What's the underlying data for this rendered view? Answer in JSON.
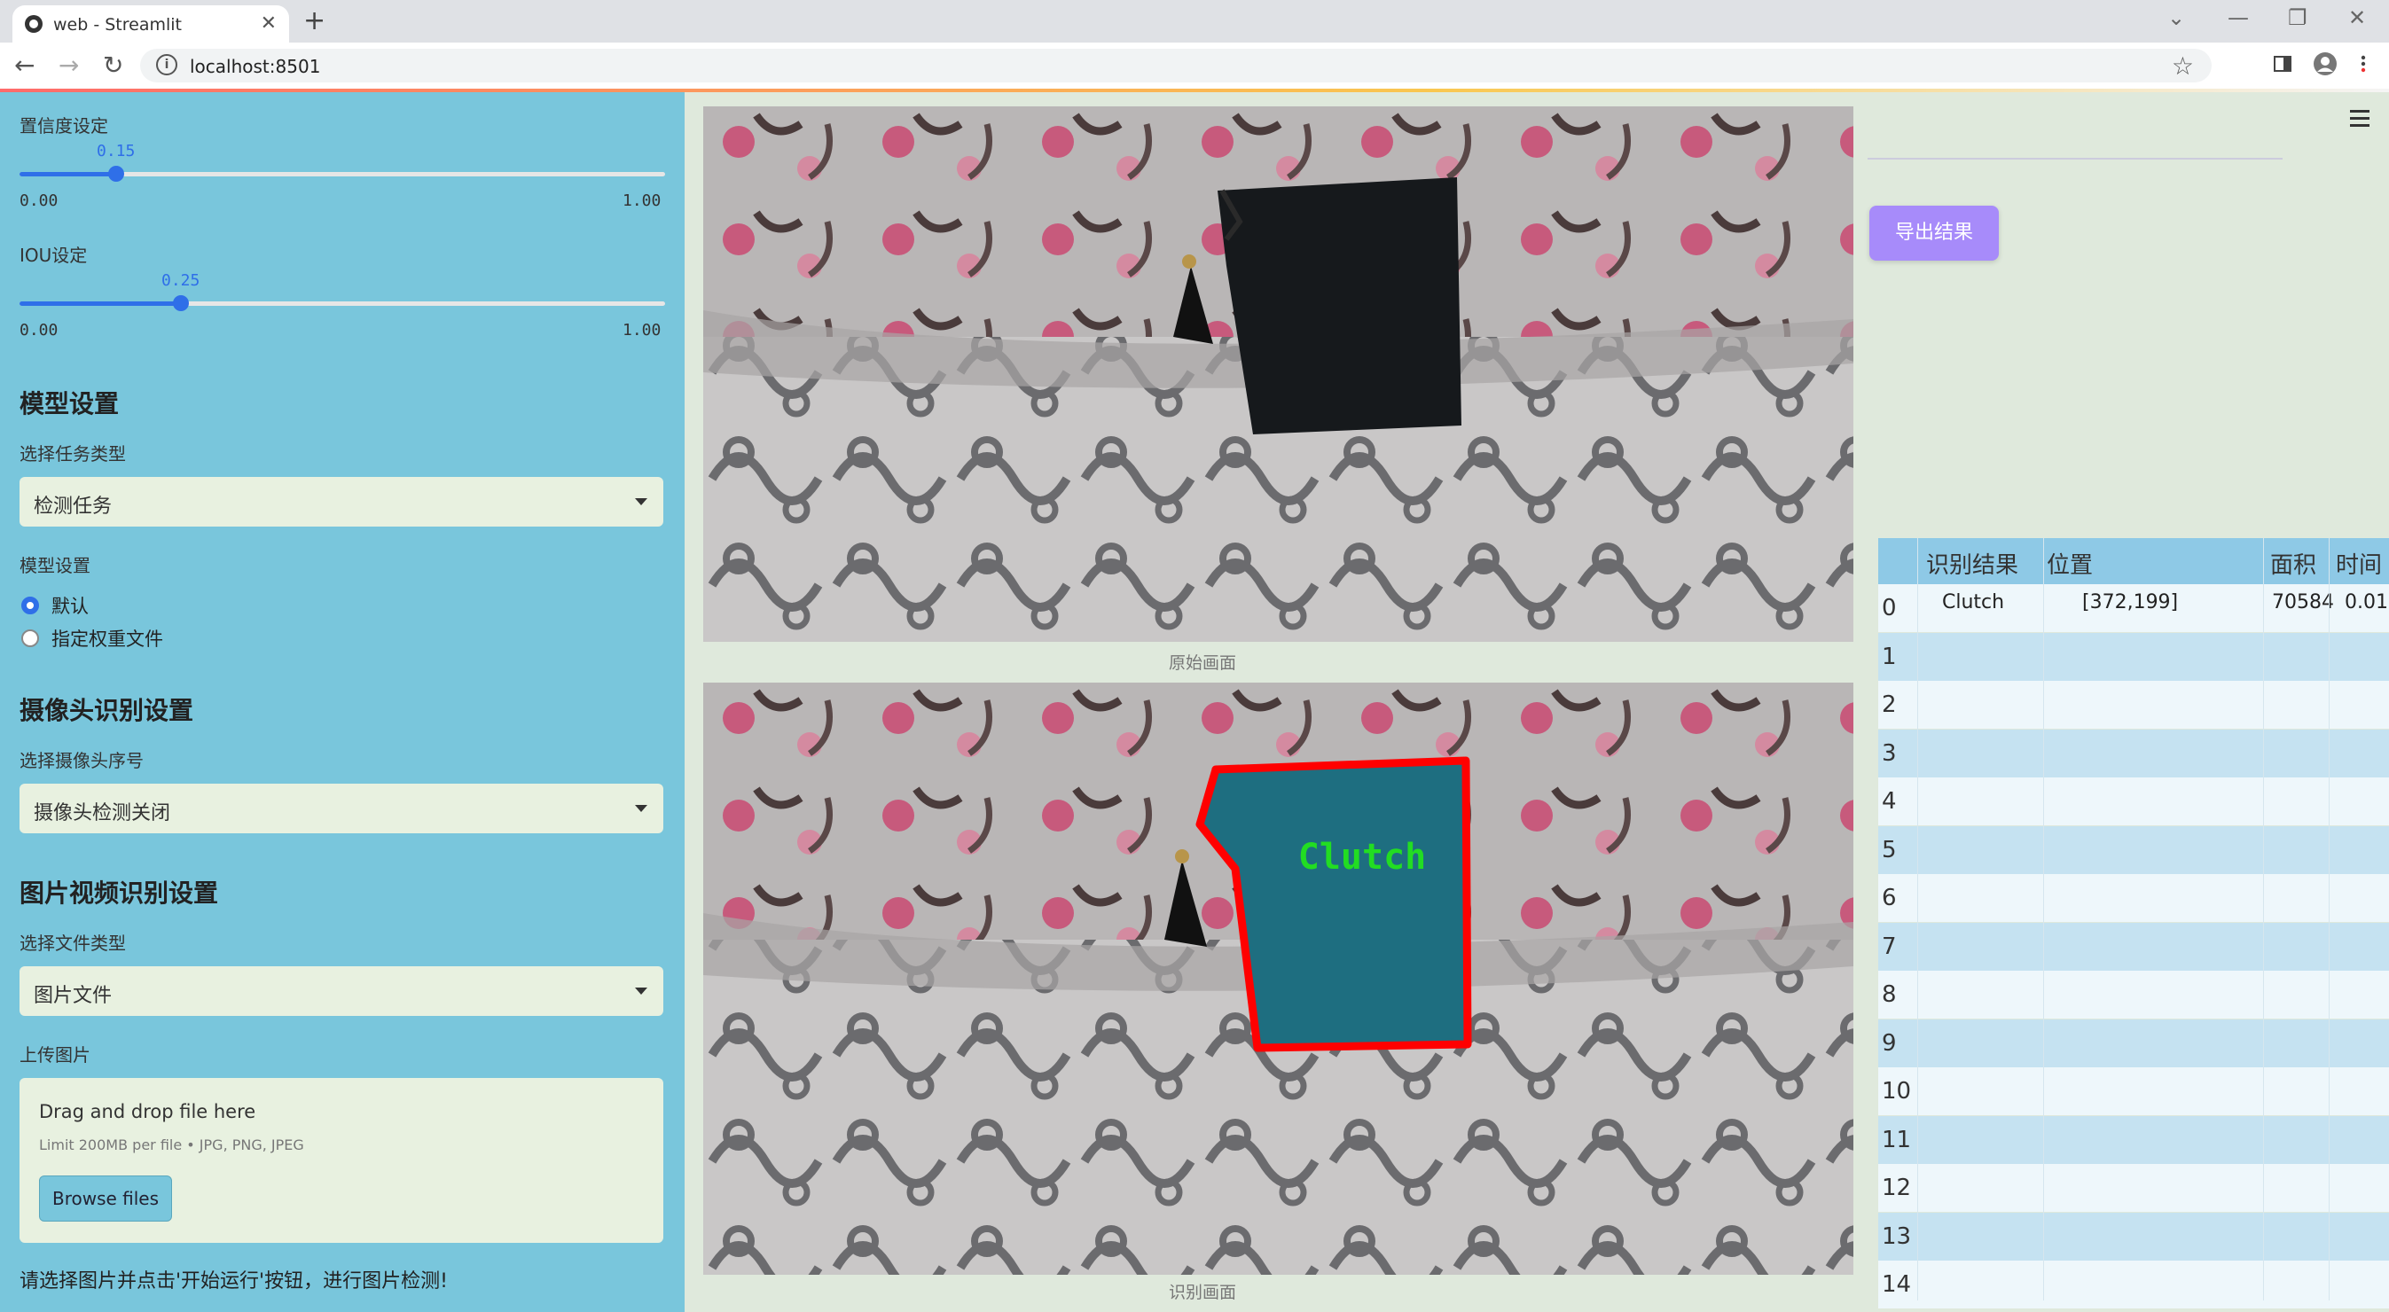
{
  "browser": {
    "tab_title": "web - Streamlit",
    "url": "localhost:8501"
  },
  "sidebar": {
    "confidence": {
      "label": "置信度设定",
      "value": "0.15",
      "value_num": 0.15,
      "min": "0.00",
      "max": "1.00"
    },
    "iou": {
      "label": "IOU设定",
      "value": "0.25",
      "value_num": 0.25,
      "min": "0.00",
      "max": "1.00"
    },
    "model_heading": "模型设置",
    "task_type_label": "选择任务类型",
    "task_type_value": "检测任务",
    "model_setting_label": "模型设置",
    "model_options": [
      "默认",
      "指定权重文件"
    ],
    "camera_heading": "摄像头识别设置",
    "camera_index_label": "选择摄像头序号",
    "camera_index_value": "摄像头检测关闭",
    "media_heading": "图片视频识别设置",
    "file_type_label": "选择文件类型",
    "file_type_value": "图片文件",
    "upload_label": "上传图片",
    "upload_drop_text": "Drag and drop file here",
    "upload_limit_text": "Limit 200MB per file • JPG, PNG, JPEG",
    "browse_button": "Browse files",
    "hint_text": "请选择图片并点击'开始运行'按钮，进行图片检测!"
  },
  "main": {
    "original_caption": "原始画面",
    "result_caption": "识别画面",
    "detection_label": "Clutch",
    "export_button": "导出结果"
  },
  "table": {
    "columns": [
      "识别结果",
      "位置",
      "面积",
      "时间"
    ],
    "rows": [
      {
        "index": "0",
        "result": "Clutch",
        "position": "[372,199]",
        "area": "70584",
        "time": "0.01"
      },
      {
        "index": "1"
      },
      {
        "index": "2"
      },
      {
        "index": "3"
      },
      {
        "index": "4"
      },
      {
        "index": "5"
      },
      {
        "index": "6"
      },
      {
        "index": "7"
      },
      {
        "index": "8"
      },
      {
        "index": "9"
      },
      {
        "index": "10"
      },
      {
        "index": "11"
      },
      {
        "index": "12"
      },
      {
        "index": "13"
      },
      {
        "index": "14"
      }
    ]
  },
  "colors": {
    "sidebar_bg": "#79c6dc",
    "accent": "#2f6fe8",
    "export_button": "#a78bfa",
    "detection_outline": "#ff0000",
    "detection_fill": "#1e6e80",
    "detection_text": "#22dd22"
  }
}
